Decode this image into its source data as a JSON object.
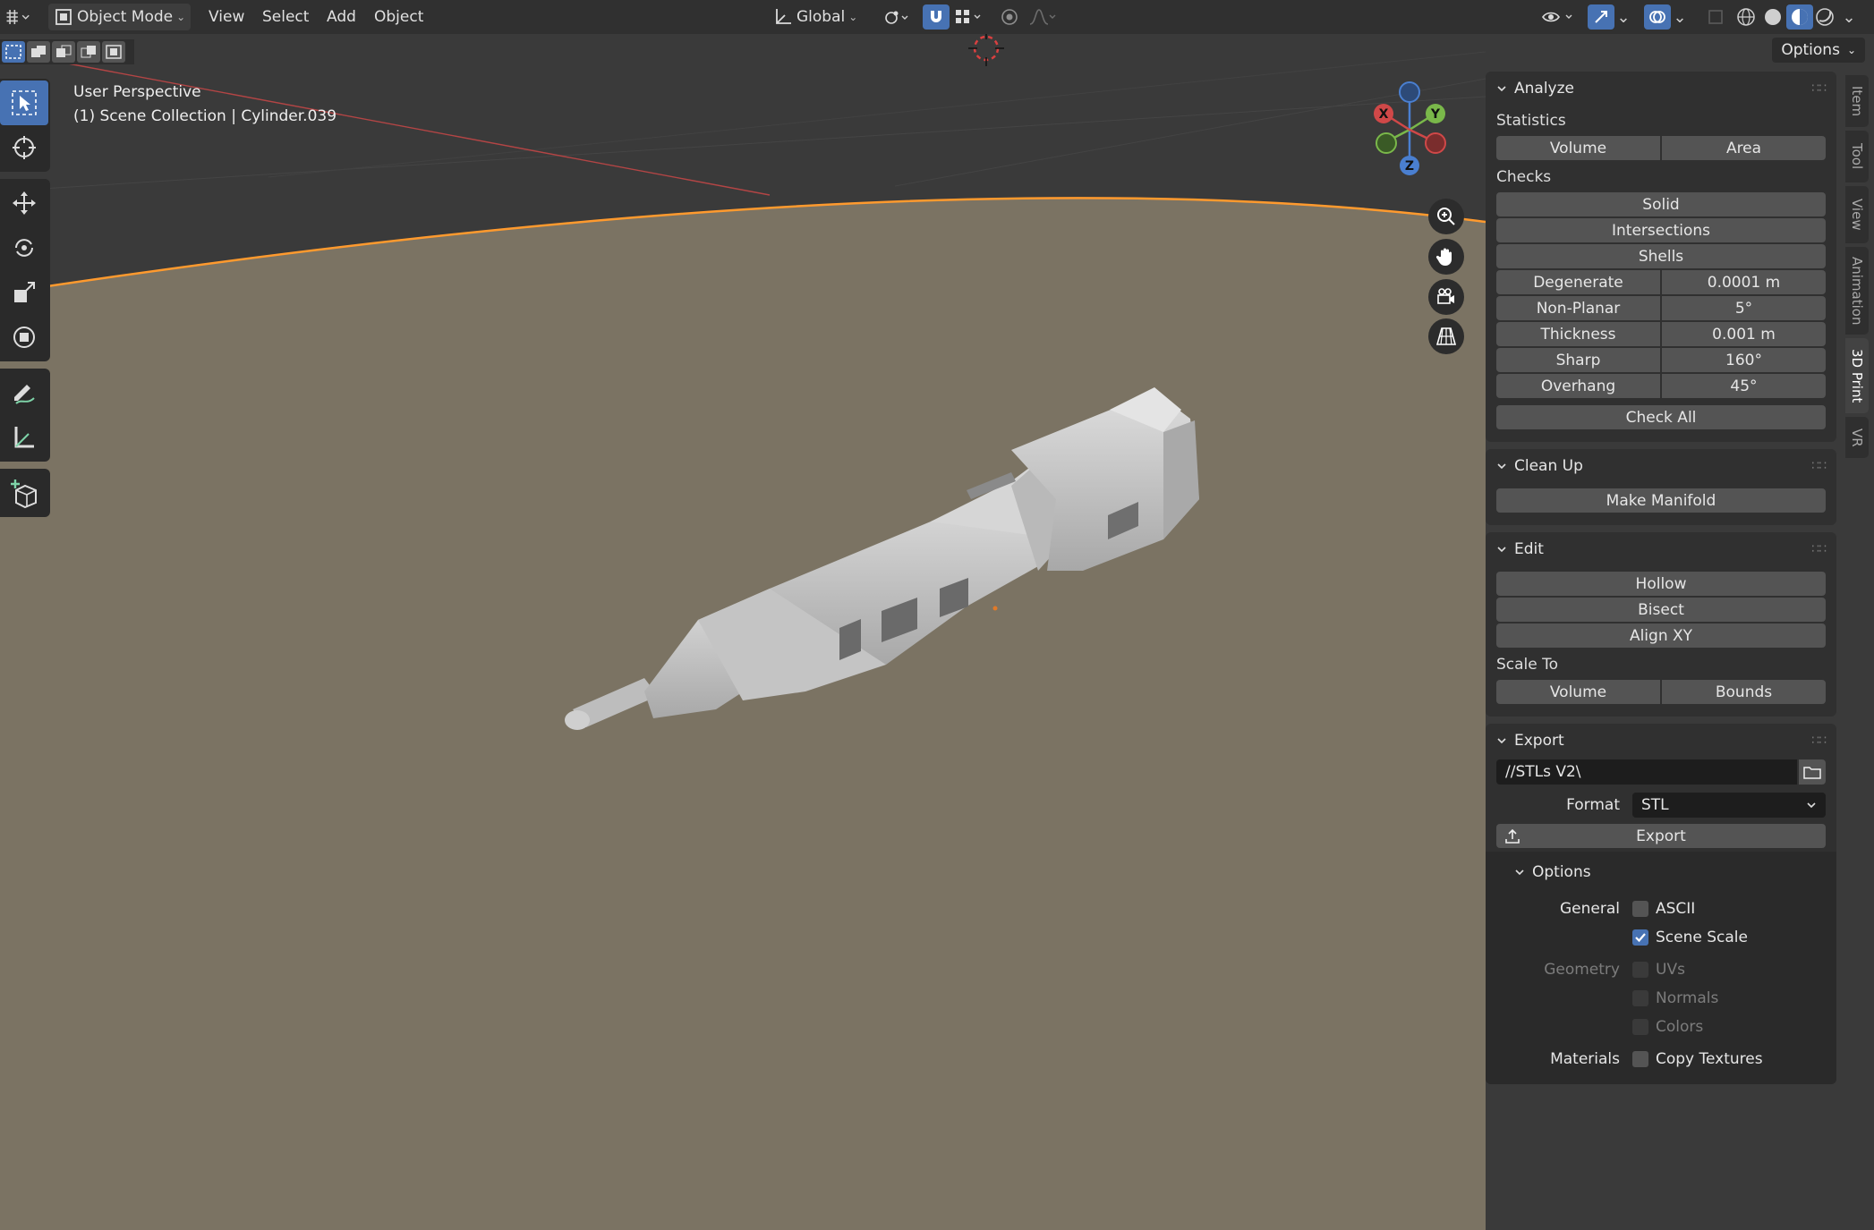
{
  "header": {
    "mode": "Object Mode",
    "menus": [
      "View",
      "Select",
      "Add",
      "Object"
    ],
    "orientation": "Global"
  },
  "viewport": {
    "perspective_label": "User Perspective",
    "collection_label": "(1) Scene Collection | Cylinder.039",
    "options_label": "Options",
    "gizmo_axes": {
      "x": "X",
      "y": "Y",
      "z": "Z"
    },
    "colors": {
      "floor": "#7b7363",
      "sky": "#3a3a3a",
      "horizon": "#ff9a2e",
      "model": "#c9c9c9"
    }
  },
  "panel": {
    "analyze": {
      "title": "Analyze",
      "statistics_label": "Statistics",
      "stat_buttons": [
        "Volume",
        "Area"
      ],
      "checks_label": "Checks",
      "check_buttons": [
        "Solid",
        "Intersections",
        "Shells"
      ],
      "checks": [
        {
          "name": "Degenerate",
          "value": "0.0001 m"
        },
        {
          "name": "Non-Planar",
          "value": "5°"
        },
        {
          "name": "Thickness",
          "value": "0.001 m"
        },
        {
          "name": "Sharp",
          "value": "160°"
        },
        {
          "name": "Overhang",
          "value": "45°"
        }
      ],
      "check_all": "Check All"
    },
    "cleanup": {
      "title": "Clean Up",
      "make_manifold": "Make Manifold"
    },
    "edit": {
      "title": "Edit",
      "buttons": [
        "Hollow",
        "Bisect",
        "Align XY"
      ],
      "scale_to_label": "Scale To",
      "scale_buttons": [
        "Volume",
        "Bounds"
      ]
    },
    "export": {
      "title": "Export",
      "path": "//STLs V2\\",
      "format_label": "Format",
      "format_value": "STL",
      "export_button": "Export",
      "options_title": "Options",
      "general_label": "General",
      "ascii_label": "ASCII",
      "scene_scale_label": "Scene Scale",
      "geometry_label": "Geometry",
      "uvs_label": "UVs",
      "normals_label": "Normals",
      "colors_label": "Colors",
      "materials_label": "Materials",
      "copy_textures_label": "Copy Textures"
    }
  },
  "tabs": [
    "Item",
    "Tool",
    "View",
    "Animation",
    "3D Print",
    "VR"
  ]
}
